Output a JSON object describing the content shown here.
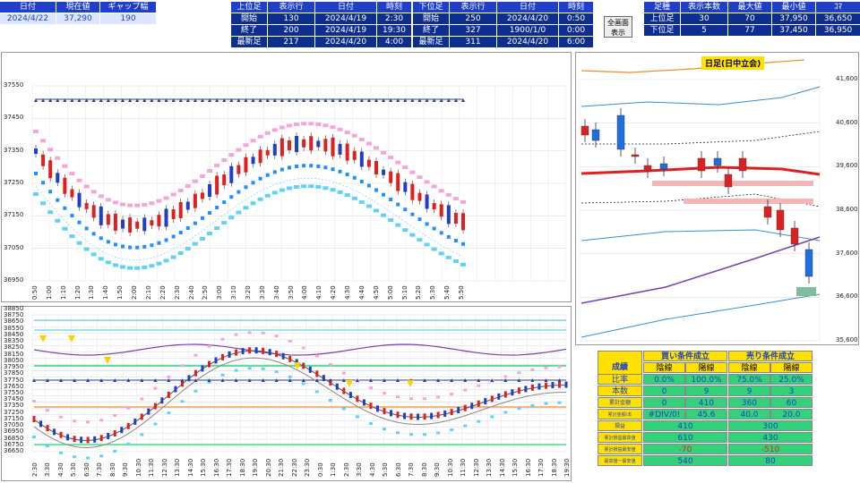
{
  "top_left": {
    "headers": [
      "日付",
      "現在値",
      "ギャップ幅"
    ],
    "values": [
      "2024/4/22",
      "37,290",
      "190"
    ]
  },
  "upper_info": {
    "headers": [
      "上位足",
      "表示行",
      "日付",
      "時刻"
    ],
    "rows": [
      [
        "開始",
        "130",
        "2024/4/19",
        "2:30"
      ],
      [
        "終了",
        "200",
        "2024/4/19",
        "19:30"
      ],
      [
        "最新足",
        "217",
        "2024/4/20",
        "4:00"
      ]
    ]
  },
  "lower_info": {
    "headers": [
      "下位足",
      "表示行",
      "日付",
      "時刻"
    ],
    "rows": [
      [
        "開始",
        "250",
        "2024/4/20",
        "0:50"
      ],
      [
        "終了",
        "327",
        "1900/1/0",
        "0:00"
      ],
      [
        "最新足",
        "311",
        "2024/4/20",
        "6:00"
      ]
    ]
  },
  "fullscreen_button": {
    "line1": "全画面",
    "line2": "表示"
  },
  "summary": {
    "headers": [
      "足種",
      "表示本数",
      "最大値",
      "最小値",
      "ｺﾏ"
    ],
    "rows": [
      [
        "上位足",
        "30",
        "70",
        "37,950",
        "36,650"
      ],
      [
        "下位足",
        "5",
        "77",
        "37,450",
        "36,950"
      ]
    ]
  },
  "chart_main": {
    "y_ticks": [
      "37550",
      "37450",
      "37350",
      "37250",
      "37150",
      "37050",
      "36950"
    ],
    "x_ticks": [
      "0:50",
      "1:00",
      "1:10",
      "1:20",
      "1:30",
      "1:40",
      "1:50",
      "2:00",
      "2:10",
      "2:20",
      "2:30",
      "2:40",
      "2:50",
      "3:00",
      "3:10",
      "3:20",
      "3:30",
      "3:40",
      "3:50",
      "4:00",
      "4:10",
      "4:20",
      "4:30",
      "4:40",
      "4:50",
      "5:00",
      "5:10",
      "5:20",
      "5:30",
      "5:40",
      "5:50"
    ]
  },
  "chart_lower": {
    "y_ticks": [
      "38850",
      "38750",
      "38650",
      "38550",
      "38450",
      "38350",
      "38250",
      "38150",
      "38050",
      "37950",
      "37850",
      "37750",
      "37650",
      "37550",
      "37450",
      "37350",
      "37250",
      "37150",
      "37050",
      "36950",
      "36850",
      "36750",
      "36650"
    ],
    "x_ticks": [
      "2:30",
      "3:30",
      "4:30",
      "5:30",
      "6:30",
      "7:30",
      "8:30",
      "9:30",
      "10:30",
      "11:30",
      "12:30",
      "13:30",
      "14:30",
      "15:30",
      "16:30",
      "17:30",
      "18:30",
      "19:30",
      "20:30",
      "21:30",
      "22:30",
      "23:30",
      "0:30",
      "1:30",
      "2:30",
      "3:30",
      "4:30",
      "5:30",
      "6:30",
      "7:30",
      "8:30",
      "9:30",
      "10:30",
      "11:30",
      "12:30",
      "13:30",
      "14:30",
      "15:30",
      "16:30",
      "17:30",
      "18:30",
      "19:30"
    ]
  },
  "chart_daily": {
    "title": "日足(日中立会)",
    "y_ticks": [
      "41,600",
      "40,600",
      "39,600",
      "38,600",
      "37,600",
      "36,600",
      "35,600"
    ]
  },
  "results": {
    "title": "成績",
    "buy_header": "買い条件成立",
    "sell_header": "売り条件成立",
    "sub_headers": [
      "陰線",
      "陽線",
      "陰線",
      "陽線"
    ],
    "rows": [
      {
        "label": "比率",
        "vals": [
          "0.0%",
          "100.0%",
          "75.0%",
          "25.0%"
        ]
      },
      {
        "label": "本数",
        "vals": [
          "0",
          "9",
          "9",
          "3"
        ]
      },
      {
        "label": "累計金額",
        "vals": [
          "0",
          "410",
          "360",
          "60"
        ]
      },
      {
        "label": "累計金額/本",
        "vals": [
          "#DIV/0!",
          "45.6",
          "40.0",
          "20.0"
        ]
      }
    ],
    "rows2": [
      {
        "label": "損益",
        "buy": "410",
        "sell": "300"
      },
      {
        "label": "累計損益最高値",
        "buy": "610",
        "sell": "430"
      },
      {
        "label": "累計損益最安値",
        "buy": "-70",
        "sell": "-510"
      },
      {
        "label": "最高値ー最安値",
        "buy": "540",
        "sell": "80"
      }
    ]
  },
  "colors": {
    "header_blue": "#1f3fc9",
    "accent_yellow": "#ffe000",
    "accent_green": "#33d17a",
    "red": "#e02020"
  }
}
